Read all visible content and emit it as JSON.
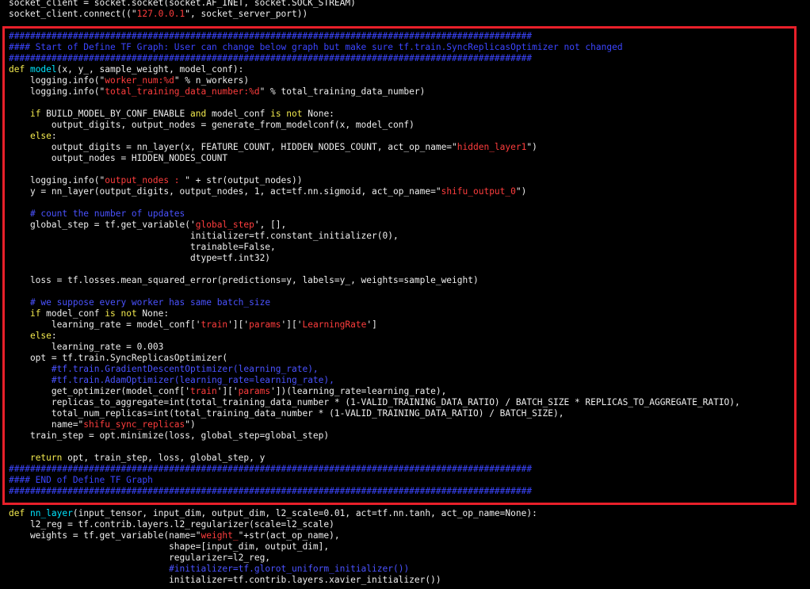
{
  "editor": {
    "accent_color": "#e8202a",
    "colors": {
      "keyword": "#f2e94e",
      "function": "#00e5ff",
      "string": "#ff3d3d",
      "comment": "#4a52ff",
      "text": "#eeeeee",
      "background": "#000000"
    },
    "lines": [
      [
        [
          "text",
          "socket_client = socket.socket(socket.AF_INET, socket.SOCK_STREAM)"
        ]
      ],
      [
        [
          "text",
          "socket_client.connect((\""
        ],
        [
          "str",
          "127.0.0.1"
        ],
        [
          "text",
          "\", socket_server_port))"
        ]
      ],
      [
        [
          "text",
          ""
        ]
      ],
      [
        [
          "hash",
          "##################################################################################################"
        ]
      ],
      [
        [
          "hash",
          "#### Start of Define TF Graph: User can change below graph but make sure tf.train.SyncReplicasOptimizer not changed"
        ]
      ],
      [
        [
          "hash",
          "##################################################################################################"
        ]
      ],
      [
        [
          "kw",
          "def "
        ],
        [
          "fn",
          "model"
        ],
        [
          "text",
          "(x, y_, sample_weight, model_conf):"
        ]
      ],
      [
        [
          "text",
          "    logging.info(\""
        ],
        [
          "str",
          "worker_num:%d"
        ],
        [
          "text",
          "\" % n_workers)"
        ]
      ],
      [
        [
          "text",
          "    logging.info(\""
        ],
        [
          "str",
          "total_training_data_number:%d"
        ],
        [
          "text",
          "\" % total_training_data_number)"
        ]
      ],
      [
        [
          "text",
          ""
        ]
      ],
      [
        [
          "text",
          "    "
        ],
        [
          "kw",
          "if"
        ],
        [
          "text",
          " BUILD_MODEL_BY_CONF_ENABLE "
        ],
        [
          "kw",
          "and"
        ],
        [
          "text",
          " model_conf "
        ],
        [
          "kw",
          "is not"
        ],
        [
          "text",
          " None:"
        ]
      ],
      [
        [
          "text",
          "        output_digits, output_nodes = generate_from_modelconf(x, model_conf)"
        ]
      ],
      [
        [
          "text",
          "    "
        ],
        [
          "kw",
          "else"
        ],
        [
          "text",
          ":"
        ]
      ],
      [
        [
          "text",
          "        output_digits = nn_layer(x, FEATURE_COUNT, HIDDEN_NODES_COUNT, act_op_name=\""
        ],
        [
          "str",
          "hidden_layer1"
        ],
        [
          "text",
          "\")"
        ]
      ],
      [
        [
          "text",
          "        output_nodes = HIDDEN_NODES_COUNT"
        ]
      ],
      [
        [
          "text",
          ""
        ]
      ],
      [
        [
          "text",
          "    logging.info(\""
        ],
        [
          "str",
          "output_nodes : "
        ],
        [
          "text",
          "\" + str(output_nodes))"
        ]
      ],
      [
        [
          "text",
          "    y = nn_layer(output_digits, output_nodes, 1, act=tf.nn.sigmoid, act_op_name=\""
        ],
        [
          "str",
          "shifu_output_0"
        ],
        [
          "text",
          "\")"
        ]
      ],
      [
        [
          "text",
          ""
        ]
      ],
      [
        [
          "text",
          "    "
        ],
        [
          "cmt",
          "# count the number of updates"
        ]
      ],
      [
        [
          "text",
          "    global_step = tf.get_variable('"
        ],
        [
          "str",
          "global_step"
        ],
        [
          "text",
          "', [],"
        ]
      ],
      [
        [
          "text",
          "                                  initializer=tf.constant_initializer(0),"
        ]
      ],
      [
        [
          "text",
          "                                  trainable=False,"
        ]
      ],
      [
        [
          "text",
          "                                  dtype=tf.int32)"
        ]
      ],
      [
        [
          "text",
          ""
        ]
      ],
      [
        [
          "text",
          "    loss = tf.losses.mean_squared_error(predictions=y, labels=y_, weights=sample_weight)"
        ]
      ],
      [
        [
          "text",
          ""
        ]
      ],
      [
        [
          "text",
          "    "
        ],
        [
          "cmt",
          "# we suppose every worker has same batch_size"
        ]
      ],
      [
        [
          "text",
          "    "
        ],
        [
          "kw",
          "if"
        ],
        [
          "text",
          " model_conf "
        ],
        [
          "kw",
          "is not"
        ],
        [
          "text",
          " None:"
        ]
      ],
      [
        [
          "text",
          "        learning_rate = model_conf['"
        ],
        [
          "str",
          "train"
        ],
        [
          "text",
          "']['"
        ],
        [
          "str",
          "params"
        ],
        [
          "text",
          "']['"
        ],
        [
          "str",
          "LearningRate"
        ],
        [
          "text",
          "']"
        ]
      ],
      [
        [
          "text",
          "    "
        ],
        [
          "kw",
          "else"
        ],
        [
          "text",
          ":"
        ]
      ],
      [
        [
          "text",
          "        learning_rate = 0.003"
        ]
      ],
      [
        [
          "text",
          "    opt = tf.train.SyncReplicasOptimizer("
        ]
      ],
      [
        [
          "text",
          "        "
        ],
        [
          "cmt",
          "#tf.train.GradientDescentOptimizer(learning_rate),"
        ]
      ],
      [
        [
          "text",
          "        "
        ],
        [
          "cmt",
          "#tf.train.AdamOptimizer(learning_rate=learning_rate),"
        ]
      ],
      [
        [
          "text",
          "        get_optimizer(model_conf['"
        ],
        [
          "str",
          "train"
        ],
        [
          "text",
          "']['"
        ],
        [
          "str",
          "params"
        ],
        [
          "text",
          "'])(learning_rate=learning_rate),"
        ]
      ],
      [
        [
          "text",
          "        replicas_to_aggregate=int(total_training_data_number * (1-VALID_TRAINING_DATA_RATIO) / BATCH_SIZE * REPLICAS_TO_AGGREGATE_RATIO),"
        ]
      ],
      [
        [
          "text",
          "        total_num_replicas=int(total_training_data_number * (1-VALID_TRAINING_DATA_RATIO) / BATCH_SIZE),"
        ]
      ],
      [
        [
          "text",
          "        name=\""
        ],
        [
          "str",
          "shifu_sync_replicas"
        ],
        [
          "text",
          "\")"
        ]
      ],
      [
        [
          "text",
          "    train_step = opt.minimize(loss, global_step=global_step)"
        ]
      ],
      [
        [
          "text",
          ""
        ]
      ],
      [
        [
          "text",
          "    "
        ],
        [
          "kw",
          "return"
        ],
        [
          "text",
          " opt, train_step, loss, global_step, y"
        ]
      ],
      [
        [
          "hash",
          "##################################################################################################"
        ]
      ],
      [
        [
          "hash",
          "#### END of Define TF Graph"
        ]
      ],
      [
        [
          "hash",
          "##################################################################################################"
        ]
      ],
      [
        [
          "text",
          ""
        ]
      ],
      [
        [
          "kw",
          "def "
        ],
        [
          "fn",
          "nn_layer"
        ],
        [
          "text",
          "(input_tensor, input_dim, output_dim, l2_scale=0.01, act=tf.nn.tanh, act_op_name=None):"
        ]
      ],
      [
        [
          "text",
          "    l2_reg = tf.contrib.layers.l2_regularizer(scale=l2_scale)"
        ]
      ],
      [
        [
          "text",
          "    weights = tf.get_variable(name=\""
        ],
        [
          "str",
          "weight_"
        ],
        [
          "text",
          "\"+str(act_op_name),"
        ]
      ],
      [
        [
          "text",
          "                              shape=[input_dim, output_dim],"
        ]
      ],
      [
        [
          "text",
          "                              regularizer=l2_reg,"
        ]
      ],
      [
        [
          "text",
          "                              "
        ],
        [
          "cmt",
          "#initializer=tf.glorot_uniform_initializer())"
        ]
      ],
      [
        [
          "text",
          "                              initializer=tf.contrib.layers.xavier_initializer())"
        ]
      ]
    ]
  }
}
